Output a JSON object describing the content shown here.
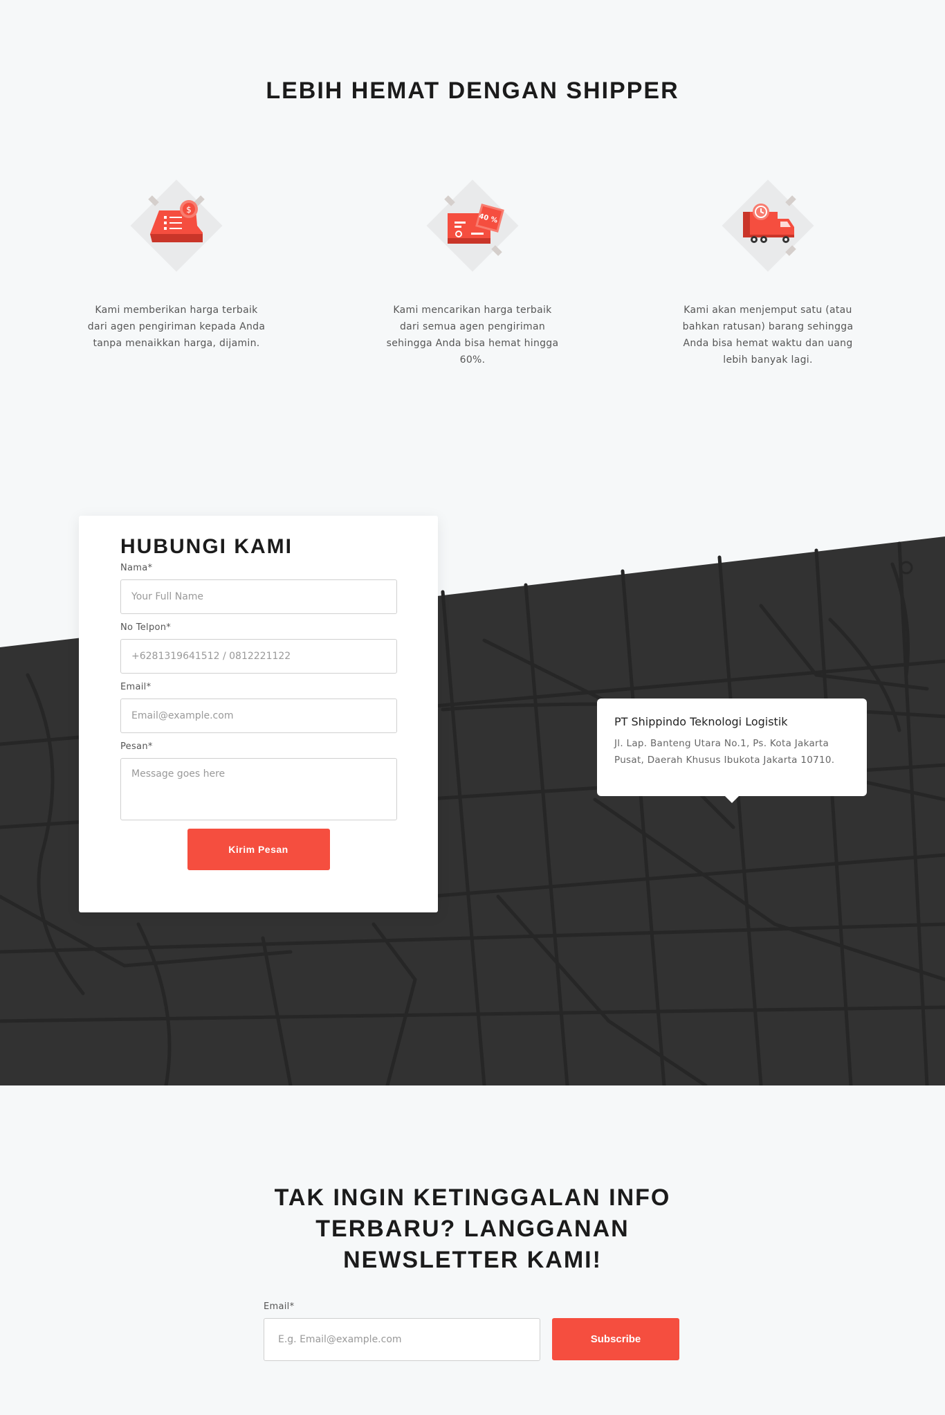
{
  "features": {
    "title": "LEBIH HEMAT DENGAN SHIPPER",
    "items": [
      {
        "icon": "price-tag-icon",
        "text": "Kami memberikan harga terbaik dari agen pengiriman kepada Anda tanpa menaikkan harga, dijamin."
      },
      {
        "icon": "discount-voucher-icon",
        "text": "Kami mencarikan harga terbaik dari semua agen pengiriman sehingga Anda bisa hemat hingga 60%.",
        "badge": "40 %"
      },
      {
        "icon": "delivery-truck-icon",
        "text": "Kami akan menjemput satu (atau bahkan ratusan) barang sehingga Anda bisa hemat waktu dan uang lebih banyak lagi."
      }
    ]
  },
  "contact": {
    "title": "HUBUNGI KAMI",
    "name_label": "Nama*",
    "name_placeholder": "Your Full Name",
    "phone_label": "No Telpon*",
    "phone_placeholder": "+6281319641512 / 0812221122",
    "email_label": "Email*",
    "email_placeholder": "Email@example.com",
    "message_label": "Pesan*",
    "message_placeholder": "Message goes here",
    "submit_label": "Kirim Pesan"
  },
  "location": {
    "company": "PT Shippindo Teknologi Logistik",
    "address": "Jl. Lap. Banteng Utara No.1, Ps. Kota Jakarta Pusat, Daerah Khusus Ibukota Jakarta 10710."
  },
  "newsletter": {
    "title_line1": "TAK INGIN KETINGGALAN INFO",
    "title_line2": "TERBARU? LANGGANAN",
    "title_line3": "NEWSLETTER KAMI!",
    "email_label": "Email*",
    "email_placeholder": "E.g. Email@example.com",
    "subscribe_label": "Subscribe"
  },
  "colors": {
    "accent": "#f54e3f",
    "map_background": "#323232",
    "page_background": "#f6f8f9"
  }
}
